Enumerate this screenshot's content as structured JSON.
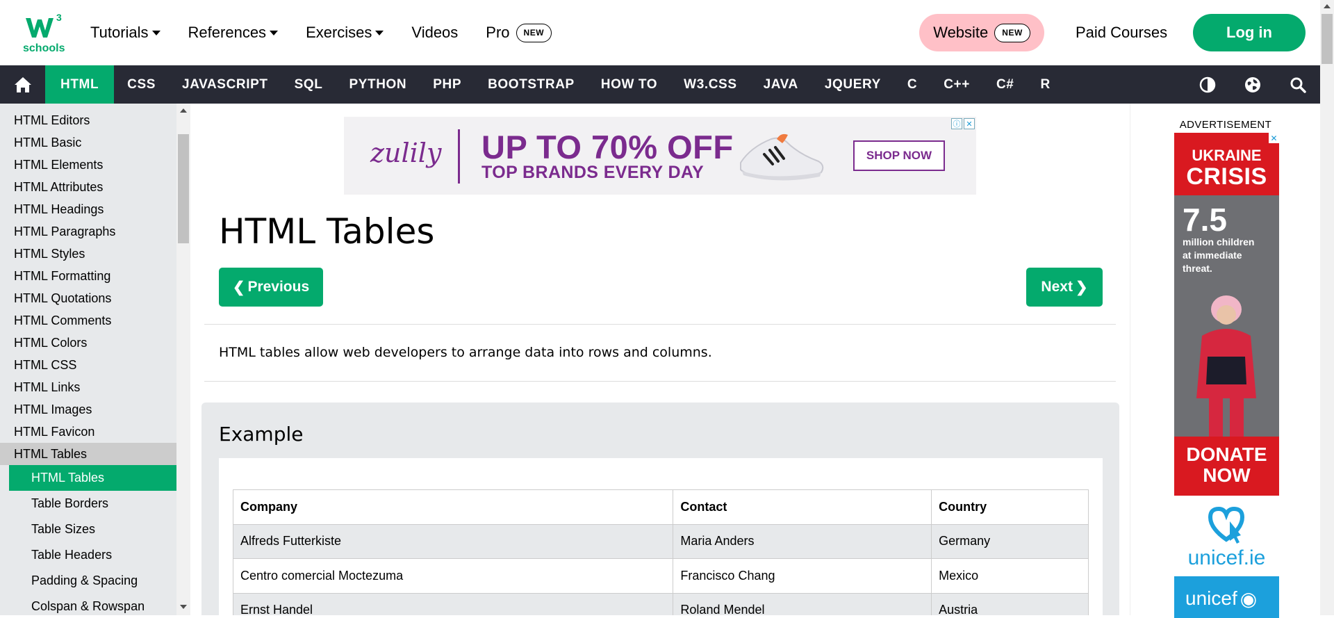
{
  "brand": {
    "logo_text": "schools",
    "logo_superscript": "3"
  },
  "topnav": {
    "items": [
      {
        "label": "Tutorials",
        "dropdown": true
      },
      {
        "label": "References",
        "dropdown": true
      },
      {
        "label": "Exercises",
        "dropdown": true
      },
      {
        "label": "Videos",
        "dropdown": false
      },
      {
        "label": "Pro",
        "badge": "NEW"
      }
    ],
    "website_label": "Website",
    "website_badge": "NEW",
    "paid_courses": "Paid Courses",
    "login": "Log in"
  },
  "darknav": {
    "home_icon": "home-icon",
    "items": [
      "HTML",
      "CSS",
      "JAVASCRIPT",
      "SQL",
      "PYTHON",
      "PHP",
      "BOOTSTRAP",
      "HOW TO",
      "W3.CSS",
      "JAVA",
      "JQUERY",
      "C",
      "C++",
      "C#",
      "R"
    ],
    "active": "HTML",
    "right_icons": [
      "contrast-icon",
      "globe-icon",
      "search-icon"
    ]
  },
  "sidebar": {
    "links": [
      "HTML Editors",
      "HTML Basic",
      "HTML Elements",
      "HTML Attributes",
      "HTML Headings",
      "HTML Paragraphs",
      "HTML Styles",
      "HTML Formatting",
      "HTML Quotations",
      "HTML Comments",
      "HTML Colors",
      "HTML CSS",
      "HTML Links",
      "HTML Images",
      "HTML Favicon"
    ],
    "group": "HTML Tables",
    "sublinks": [
      "HTML Tables",
      "Table Borders",
      "Table Sizes",
      "Table Headers",
      "Padding & Spacing",
      "Colspan & Rowspan"
    ],
    "active_sub": "HTML Tables"
  },
  "ad_top": {
    "brand": "zulily",
    "headline": "UP TO 70% OFF",
    "subline": "TOP BRANDS EVERY DAY",
    "cta": "SHOP NOW"
  },
  "main": {
    "title": "HTML Tables",
    "prev": "Previous",
    "next": "Next",
    "intro": "HTML tables allow web developers to arrange data into rows and columns.",
    "example_heading": "Example",
    "table": {
      "headers": [
        "Company",
        "Contact",
        "Country"
      ],
      "rows": [
        [
          "Alfreds Futterkiste",
          "Maria Anders",
          "Germany"
        ],
        [
          "Centro comercial Moctezuma",
          "Francisco Chang",
          "Mexico"
        ],
        [
          "Ernst Handel",
          "Roland Mendel",
          "Austria"
        ]
      ]
    }
  },
  "right_ad": {
    "label": "ADVERTISEMENT",
    "headline_1": "UKRAINE",
    "headline_2": "CRISIS",
    "stat": "7.5",
    "stat_text": [
      "million children",
      "at immediate",
      "threat."
    ],
    "cta": "DONATE NOW",
    "site": "unicef.ie",
    "logo": "unicef"
  },
  "colors": {
    "accent": "#04aa6d",
    "dark": "#282a35",
    "sidebar": "#e7e9eb",
    "pink": "#ffc0c7",
    "ad_purple": "#7b2b8e",
    "unicef_blue": "#1ca0dc",
    "alert_red": "#d91920"
  }
}
